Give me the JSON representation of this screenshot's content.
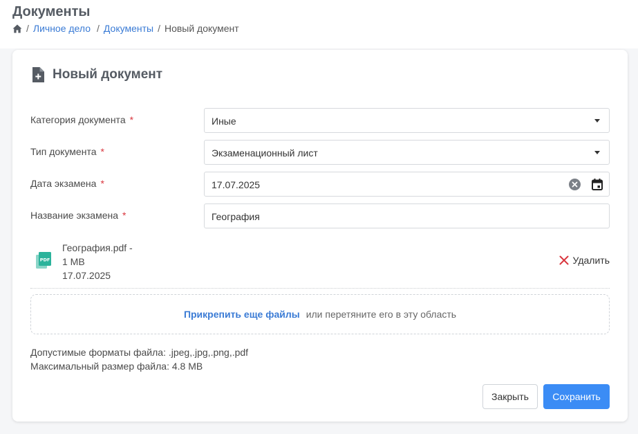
{
  "page": {
    "title": "Документы",
    "breadcrumb": {
      "home_icon": "home-icon",
      "items": [
        "Личное дело",
        "Документы"
      ],
      "current": "Новый документ",
      "separator": "/"
    }
  },
  "card": {
    "icon": "file-plus-icon",
    "title": "Новый документ"
  },
  "form": {
    "required_mark": "*",
    "category": {
      "label": "Категория документа",
      "value": "Иные"
    },
    "type": {
      "label": "Тип документа",
      "value": "Экзаменационный лист"
    },
    "exam_date": {
      "label": "Дата экзамена",
      "value": "17.07.2025"
    },
    "exam_name": {
      "label": "Название экзамена",
      "value": "География"
    }
  },
  "file": {
    "icon": "pdf-icon",
    "name_line": "География.pdf -",
    "size_line": "1 MB",
    "date_line": "17.07.2025",
    "delete_label": "Удалить"
  },
  "dropzone": {
    "attach_label": "Прикрепить еще файлы",
    "hint": "или перетяните его в эту область"
  },
  "info": {
    "formats": "Допустимые форматы файла: .jpeg,.jpg,.png,.pdf",
    "max_size": "Максимальный размер файла: 4.8 MB"
  },
  "actions": {
    "close_label": "Закрыть",
    "save_label": "Сохранить"
  },
  "colors": {
    "accent": "#3b8cf5",
    "link": "#3a7bd5",
    "required": "#d9363e",
    "pdf_icon": "#2bb39b"
  }
}
